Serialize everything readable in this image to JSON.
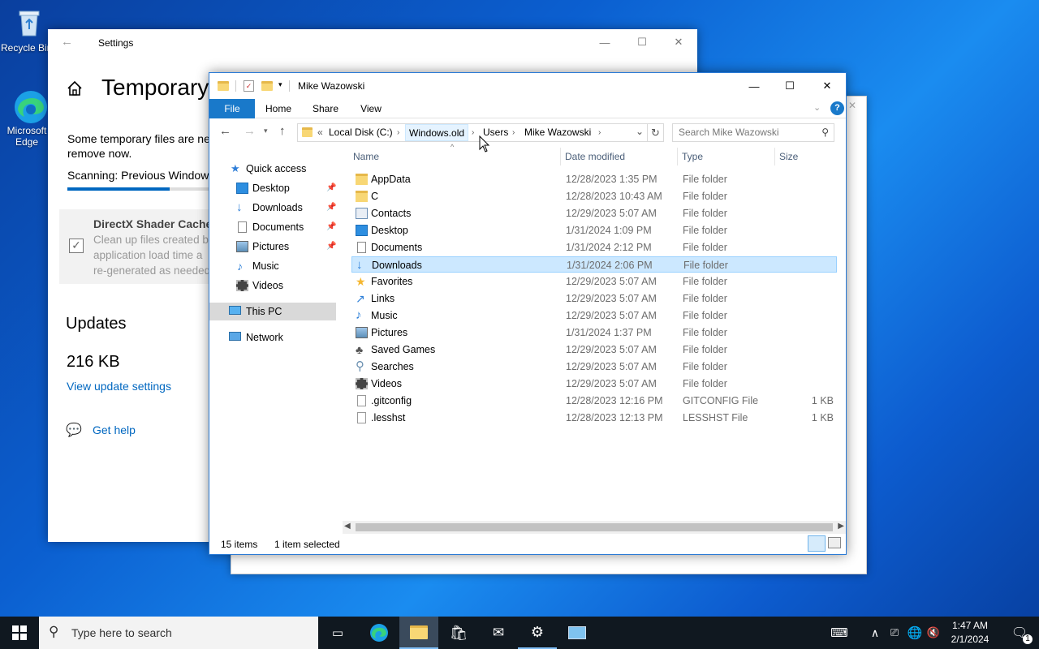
{
  "desktop": {
    "icons": [
      {
        "label": "Recycle Bin"
      },
      {
        "label": "Microsoft Edge"
      }
    ]
  },
  "settings": {
    "title": "Settings",
    "heading": "Temporary",
    "desc": "Some temporary files are ne\nremove now.",
    "desc_line1": "Some temporary files are ne",
    "desc_line2": "remove now.",
    "scanning": "Scanning: Previous Windows",
    "progress": 0.7,
    "item_title": "DirectX Shader Cache",
    "item_desc_1": "Clean up files created b",
    "item_desc_2": "application load time a",
    "item_desc_3": "re-generated as needed",
    "updates_heading": "Updates",
    "updates_size": "216 KB",
    "view_update_link": "View update settings",
    "get_help": "Get help"
  },
  "explorer": {
    "title": "Mike Wazowski",
    "ribbon_tabs": [
      "File",
      "Home",
      "Share",
      "View"
    ],
    "breadcrumb": [
      "Local Disk (C:)",
      "Windows.old",
      "Users",
      "Mike Wazowski"
    ],
    "breadcrumb_prefix": "«",
    "search_placeholder": "Search Mike Wazowski",
    "nav": {
      "quick_access": "Quick access",
      "items": [
        {
          "label": "Desktop",
          "pinned": true
        },
        {
          "label": "Downloads",
          "pinned": true
        },
        {
          "label": "Documents",
          "pinned": true
        },
        {
          "label": "Pictures",
          "pinned": true
        },
        {
          "label": "Music",
          "pinned": false
        },
        {
          "label": "Videos",
          "pinned": false
        }
      ],
      "this_pc": "This PC",
      "network": "Network"
    },
    "columns": {
      "name": "Name",
      "date": "Date modified",
      "type": "Type",
      "size": "Size"
    },
    "files": [
      {
        "name": "AppData",
        "date": "12/28/2023 1:35 PM",
        "type": "File folder",
        "size": "",
        "icon": "folder-icon"
      },
      {
        "name": "C",
        "date": "12/28/2023 10:43 AM",
        "type": "File folder",
        "size": "",
        "icon": "folder-icon"
      },
      {
        "name": "Contacts",
        "date": "12/29/2023 5:07 AM",
        "type": "File folder",
        "size": "",
        "icon": "contacts-icon"
      },
      {
        "name": "Desktop",
        "date": "1/31/2024 1:09 PM",
        "type": "File folder",
        "size": "",
        "icon": "desktop-icon"
      },
      {
        "name": "Documents",
        "date": "1/31/2024 2:12 PM",
        "type": "File folder",
        "size": "",
        "icon": "documents-icon"
      },
      {
        "name": "Downloads",
        "date": "1/31/2024 2:06 PM",
        "type": "File folder",
        "size": "",
        "icon": "downloads-icon",
        "selected": true
      },
      {
        "name": "Favorites",
        "date": "12/29/2023 5:07 AM",
        "type": "File folder",
        "size": "",
        "icon": "star-icon"
      },
      {
        "name": "Links",
        "date": "12/29/2023 5:07 AM",
        "type": "File folder",
        "size": "",
        "icon": "links-icon"
      },
      {
        "name": "Music",
        "date": "12/29/2023 5:07 AM",
        "type": "File folder",
        "size": "",
        "icon": "music-icon"
      },
      {
        "name": "Pictures",
        "date": "1/31/2024 1:37 PM",
        "type": "File folder",
        "size": "",
        "icon": "pictures-icon"
      },
      {
        "name": "Saved Games",
        "date": "12/29/2023 5:07 AM",
        "type": "File folder",
        "size": "",
        "icon": "saved-games-icon"
      },
      {
        "name": "Searches",
        "date": "12/29/2023 5:07 AM",
        "type": "File folder",
        "size": "",
        "icon": "search-icon"
      },
      {
        "name": "Videos",
        "date": "12/29/2023 5:07 AM",
        "type": "File folder",
        "size": "",
        "icon": "videos-icon"
      },
      {
        "name": ".gitconfig",
        "date": "12/28/2023 12:16 PM",
        "type": "GITCONFIG File",
        "size": "1 KB",
        "icon": "file-icon"
      },
      {
        "name": ".lesshst",
        "date": "12/28/2023 12:13 PM",
        "type": "LESSHST File",
        "size": "1 KB",
        "icon": "file-icon"
      }
    ],
    "status_items": "15 items",
    "status_selected": "1 item selected"
  },
  "taskbar": {
    "search_placeholder": "Type here to search",
    "time": "1:47 AM",
    "date": "2/1/2024",
    "notification_count": "1"
  }
}
